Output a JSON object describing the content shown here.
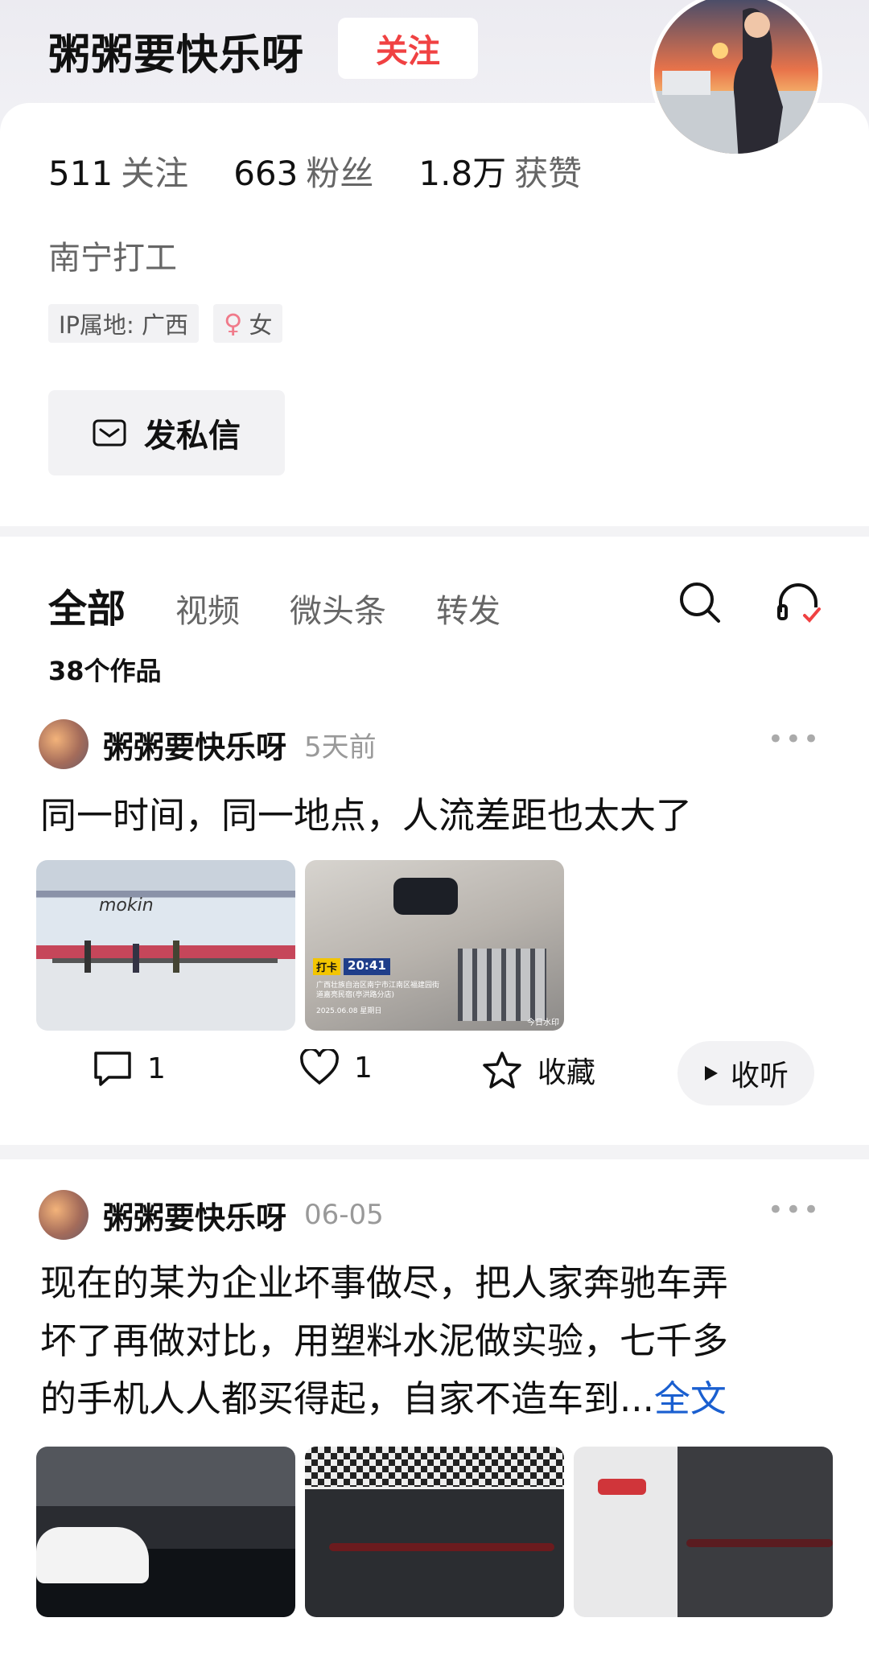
{
  "profile": {
    "name": "粥粥要快乐呀",
    "follow_label": "关注",
    "stats": [
      {
        "value": "511",
        "label": "关注"
      },
      {
        "value": "663",
        "label": "粉丝"
      },
      {
        "value": "1.8万",
        "label": "获赞"
      }
    ],
    "bio": "南宁打工",
    "tags": {
      "ip": "IP属地: 广西",
      "gender": "女"
    },
    "message_label": "发私信"
  },
  "tabs": {
    "items": [
      "全部",
      "视频",
      "微头条",
      "转发"
    ],
    "active": "全部",
    "works_count": "38个作品"
  },
  "posts": [
    {
      "author": "粥粥要快乐呀",
      "time": "5天前",
      "text": "同一时间，同一地点，人流差距也太大了",
      "image_overlay": {
        "brand": "mokin",
        "badge": "打卡",
        "clock": "20:41",
        "address": "广西壮族自治区南宁市江南区福建园街道嘉亮民宿(亭洪路分店)",
        "date": "2025.06.08 星期日",
        "watermark": "今日水印"
      },
      "actions": {
        "comments": "1",
        "likes": "1",
        "favorite_label": "收藏",
        "listen_label": "收听"
      }
    },
    {
      "author": "粥粥要快乐呀",
      "time": "06-05",
      "text_lines": [
        "现在的某为企业坏事做尽，把人家奔驰车弄",
        "坏了再做对比，用塑料水泥做实验，七千多",
        "的手机人人都买得起，自家不造车到..."
      ],
      "full_text_label": "全文"
    }
  ],
  "colors": {
    "follow": "#f04142",
    "link": "#1a5fd0",
    "bg": "#f3f3f5"
  }
}
